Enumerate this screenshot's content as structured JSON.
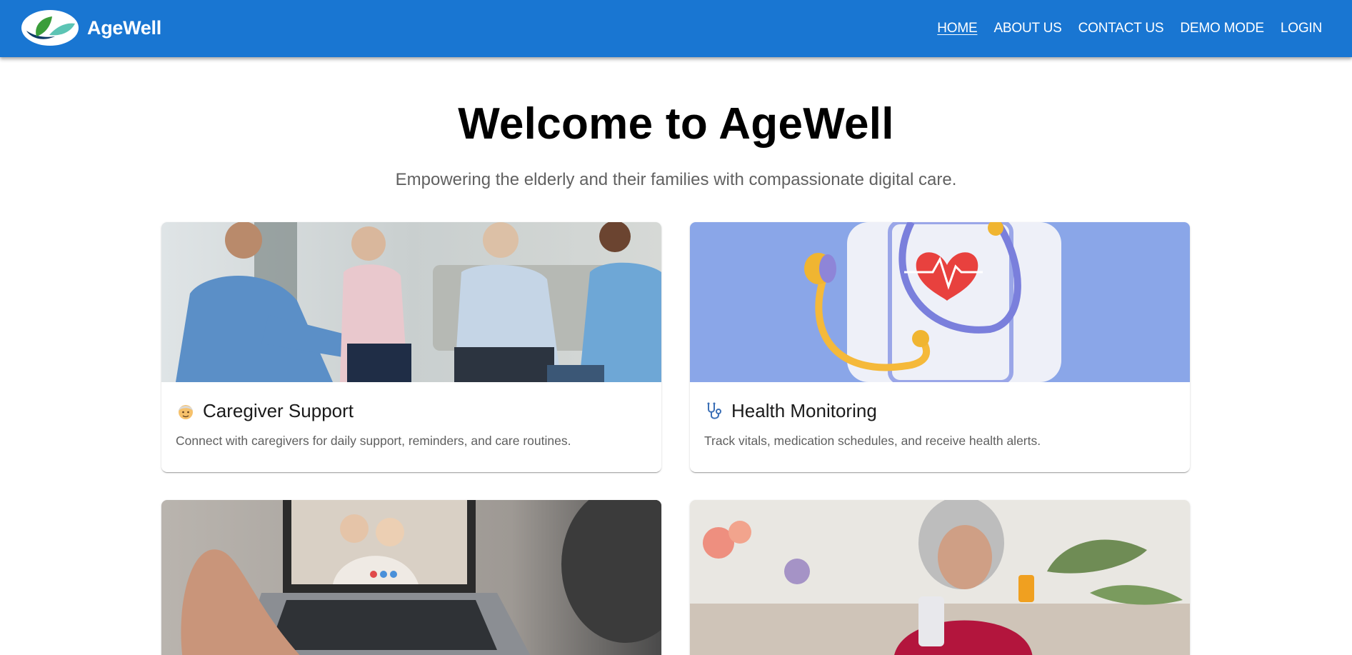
{
  "header": {
    "brand": "AgeWell",
    "nav": [
      {
        "label": "HOME",
        "active": true
      },
      {
        "label": "ABOUT US",
        "active": false
      },
      {
        "label": "CONTACT US",
        "active": false
      },
      {
        "label": "DEMO MODE",
        "active": false
      },
      {
        "label": "LOGIN",
        "active": false
      }
    ]
  },
  "hero": {
    "title": "Welcome to AgeWell",
    "subtitle": "Empowering the elderly and their families with compassionate digital care."
  },
  "cards": [
    {
      "icon": "elderly-person-icon",
      "title": "Caregiver Support",
      "description": "Connect with caregivers for daily support, reminders, and care routines."
    },
    {
      "icon": "stethoscope-icon",
      "title": "Health Monitoring",
      "description": "Track vitals, medication schedules, and receive health alerts."
    },
    {
      "icon": "",
      "title": "",
      "description": ""
    },
    {
      "icon": "",
      "title": "",
      "description": ""
    }
  ],
  "colors": {
    "appbar": "#1976d2",
    "text_primary": "#000000",
    "text_secondary": "#616161",
    "health_bg": "#8aa6e8"
  }
}
